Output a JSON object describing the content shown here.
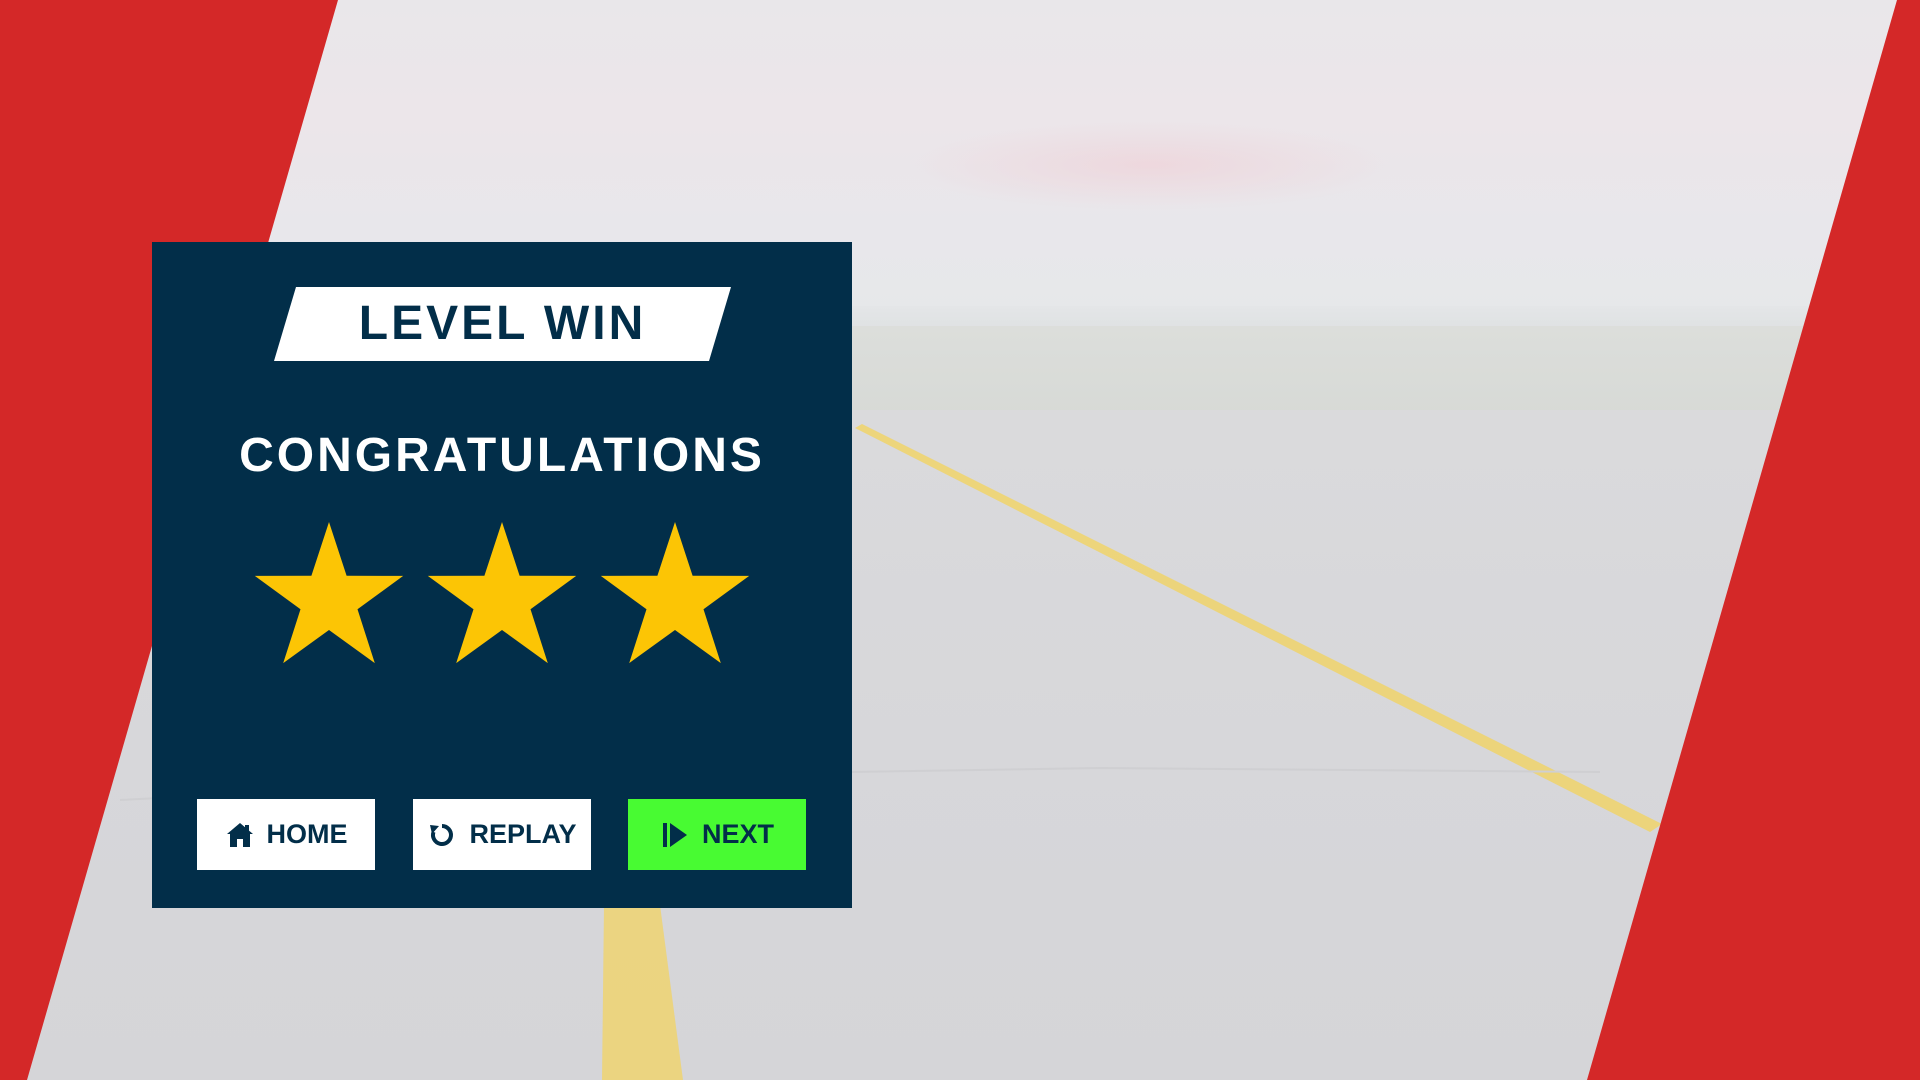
{
  "title": "LEVEL WIN",
  "subtitle": "CONGRATULATIONS",
  "stars": {
    "earned": 3,
    "total": 3
  },
  "buttons": {
    "home": {
      "label": "HOME",
      "icon": "home-icon"
    },
    "replay": {
      "label": "REPLAY",
      "icon": "replay-icon"
    },
    "next": {
      "label": "NEXT",
      "icon": "play-next-icon"
    }
  },
  "colors": {
    "panel": "#022e49",
    "frame_red": "#d42828",
    "star": "#fcc505",
    "next_button": "#48fb32",
    "button": "#ffffff",
    "road_line": "#f0d36a"
  }
}
